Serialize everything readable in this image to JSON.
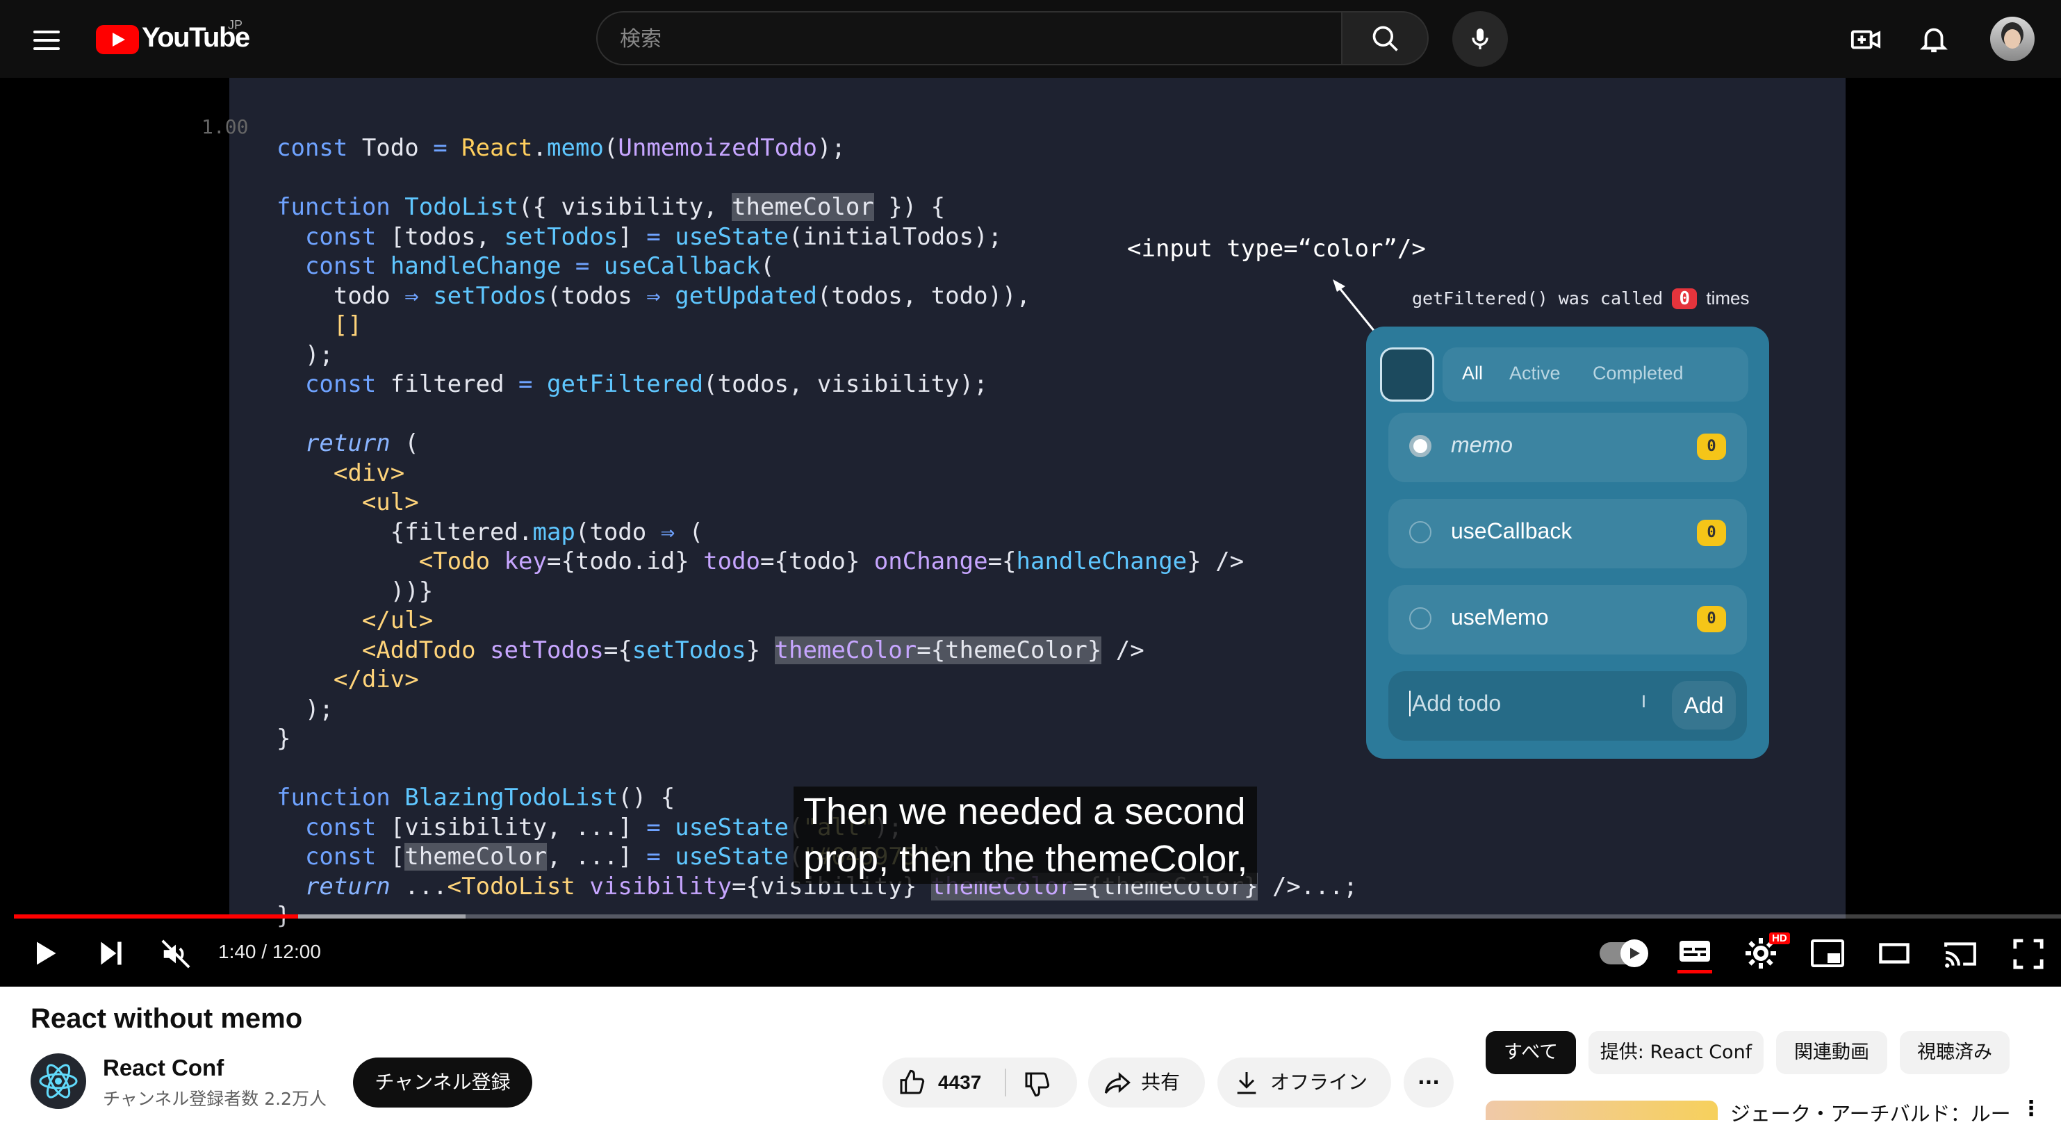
{
  "header": {
    "logo_text": "YouTube",
    "region": "JP",
    "search_placeholder": "検索"
  },
  "video": {
    "line_indicator": "1.00",
    "code_lines": [
      "const Todo = React.memo(UnmemoizedTodo);",
      "",
      "function TodoList({ visibility, themeColor }) {",
      "  const [todos, setTodos] = useState(initialTodos);",
      "  const handleChange = useCallback(",
      "    todo ⇒ setTodos(todos ⇒ getUpdated(todos, todo)),",
      "    []",
      "  );",
      "  const filtered = getFiltered(todos, visibility);",
      "",
      "  return (",
      "    <div>",
      "      <ul>",
      "        {filtered.map(todo ⇒ (",
      "          <Todo key={todo.id} todo={todo} onChange={handleChange} />",
      "        ))}",
      "      </ul>",
      "      <AddTodo setTodos={setTodos} themeColor={themeColor} />",
      "    </div>",
      "  );",
      "}",
      "",
      "function BlazingTodoList() {",
      "  const [visibility, ...] = useState(\"all\");",
      "  const [themeColor, ...] = useState(\"#045975\");",
      "  return ...<TodoList visibility={visibility} themeColor={themeColor} />...;",
      "}"
    ],
    "annotation": "<input type=“color”/>",
    "counter_prefix": "getFiltered() was called",
    "counter_value": "0",
    "counter_suffix": "times",
    "widget": {
      "filters": [
        "All",
        "Active",
        "Completed"
      ],
      "todos": [
        {
          "label": "memo",
          "badge": "0"
        },
        {
          "label": "useCallback",
          "badge": "0"
        },
        {
          "label": "useMemo",
          "badge": "0"
        }
      ],
      "add_placeholder": "Add todo",
      "add_button": "Add"
    },
    "caption_line1": "Then we needed a second",
    "caption_line2": "prop, then the themeColor,",
    "progress": 0.139,
    "time": "1:40 / 12:00",
    "hd_badge": "HD"
  },
  "info": {
    "title": "React without memo",
    "channel": "React Conf",
    "subscribers": "チャンネル登録者数 2.2万人",
    "subscribe_button": "チャンネル登録",
    "likes": "4437",
    "share": "共有",
    "download": "オフライン"
  },
  "chips": [
    "すべて",
    "提供: React Conf",
    "関連動画",
    "視聴済み"
  ],
  "related": {
    "first_title": "ジェーク・アーチバルド：ルー"
  },
  "colors": {
    "youtube_red": "#ff0000",
    "widget_bg": "#2c7a9a",
    "slide_bg": "#1e2230"
  }
}
